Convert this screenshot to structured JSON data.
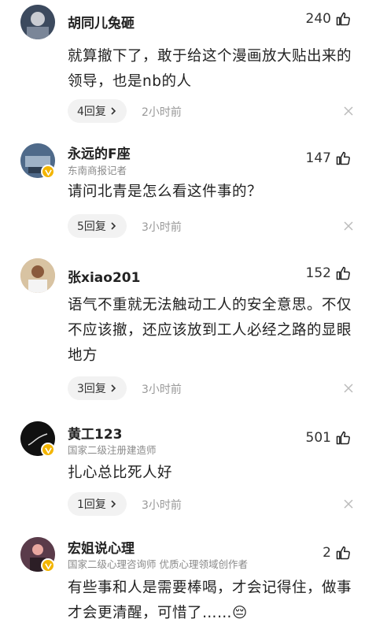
{
  "comments": [
    {
      "username": "胡同儿兔砸",
      "tag": "",
      "likes": "240",
      "text": "就算撤下了，敢于给这个漫画放大贴出来的领导，也是nb的人",
      "replies": "4回复",
      "time": "2小时前",
      "verified": false,
      "avatar_color": "#3c4a5e"
    },
    {
      "username": "永远的F座",
      "tag": "东南商报记者",
      "likes": "147",
      "text": "请问北青是怎么看这件事的？",
      "replies": "5回复",
      "time": "3小时前",
      "verified": true,
      "avatar_color": "#4f6a8a"
    },
    {
      "username": "张xiao201",
      "tag": "",
      "likes": "152",
      "text": "语气不重就无法触动工人的安全意思。不仅不应该撤，还应该放到工人必经之路的显眼地方",
      "replies": "3回复",
      "time": "3小时前",
      "verified": false,
      "avatar_color": "#c9a27a"
    },
    {
      "username": "黄工123",
      "tag": "国家二级注册建造师",
      "likes": "501",
      "text": "扎心总比死人好",
      "replies": "1回复",
      "time": "3小时前",
      "verified": true,
      "avatar_color": "#111111"
    },
    {
      "username": "宏姐说心理",
      "tag": "国家二级心理咨询师 优质心理领域创作者",
      "likes": "2",
      "text": "有些事和人是需要棒喝，才会记得住，做事才会更清醒，可惜了……😔",
      "replies": "",
      "time": "",
      "verified": true,
      "avatar_color": "#5a3b4a"
    }
  ],
  "icons": {
    "like": "thumbs-up-icon",
    "close": "close-icon",
    "chevron": "chevron-right-icon",
    "verified": "verified-badge-icon"
  },
  "colors": {
    "verified_badge": "#f3b500",
    "pill_bg": "#f2f2f2",
    "meta_text": "#999999"
  }
}
